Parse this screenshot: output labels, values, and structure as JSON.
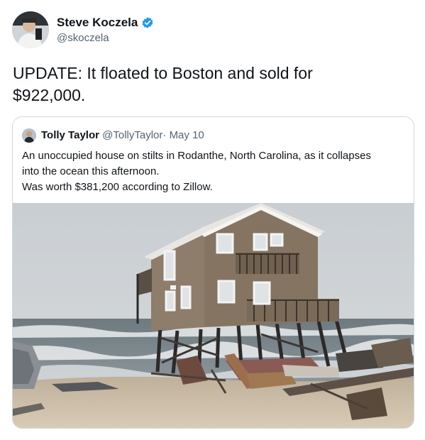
{
  "tweet": {
    "author_name": "Steve Koczela",
    "author_handle": "@skoczela",
    "text_line1": "UPDATE: It floated to Boston and sold for",
    "text_line2": "$922,000."
  },
  "quoted": {
    "author_name": "Tolly Taylor",
    "author_handle": "@TollyTaylor",
    "separator": "·",
    "date": "May 10",
    "line1": "An unoccupied house on stilts in Rodanthe, North Carolina, as it collapses",
    "line2": "into the ocean this afternoon.",
    "line3": "Was worth $381,200 according to Zillow."
  },
  "colors": {
    "verified": "#1d9bf0",
    "secondary_text": "#536471",
    "border": "#cfd9de"
  },
  "icons": {
    "verified": "verified-badge-icon"
  }
}
